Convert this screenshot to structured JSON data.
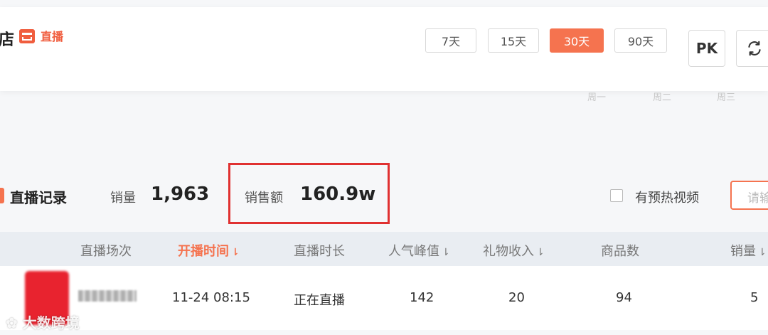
{
  "shop": {
    "name_fragment": "店",
    "live_tag": "直播"
  },
  "ranges": [
    "7天",
    "15天",
    "30天",
    "90天"
  ],
  "active_range": "30天",
  "pk_label": "PK",
  "week_labels": [
    "周一",
    "周二",
    "周三"
  ],
  "live_records": {
    "title": "直播记录",
    "sales_label": "销量",
    "sales_value": "1,963",
    "revenue_label": "销售额",
    "revenue_value": "160.9w",
    "preheat_label": "有预热视频",
    "search_placeholder": "请输"
  },
  "table": {
    "headers": [
      "直播场次",
      "开播时间",
      "直播时长",
      "人气峰值",
      "礼物收入",
      "商品数",
      "销量"
    ],
    "sort_arrow": "⇂",
    "row": {
      "start_time": "11-24 08:15",
      "duration": "正在直播",
      "peak": "142",
      "gifts": "20",
      "products": "94",
      "sales": "5"
    }
  },
  "watermark": "大数跨境",
  "colors": {
    "accent": "#f5734f",
    "highlight": "#e03131",
    "brand_red": "#f05d3e"
  }
}
